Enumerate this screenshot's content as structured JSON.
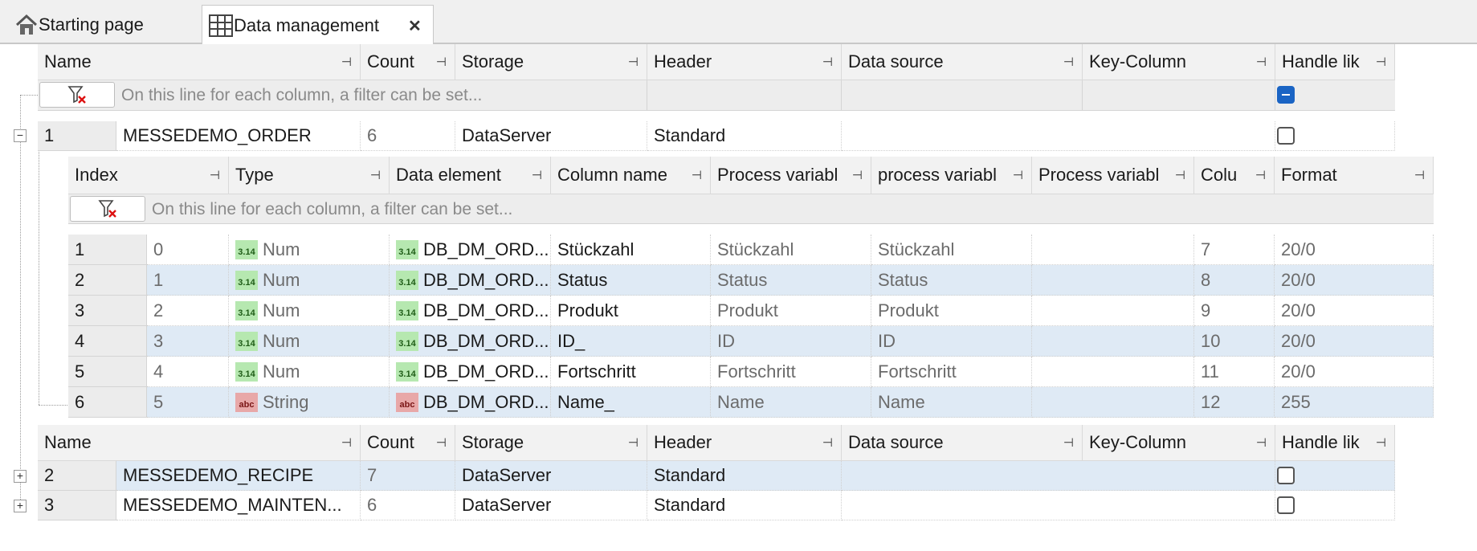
{
  "tabs": [
    {
      "label": "Starting page",
      "icon": "home-icon"
    },
    {
      "label": "Data management",
      "icon": "table-grid-icon",
      "close": "✕"
    }
  ],
  "outer_columns": [
    "Name",
    "Count",
    "Storage",
    "Header",
    "Data source",
    "Key-Column",
    "Handle lik"
  ],
  "filter_placeholder": "On this line for each column, a filter can be set...",
  "tables": [
    {
      "index": "1",
      "name": "MESSEDEMO_ORDER",
      "count": "6",
      "storage": "DataServer",
      "header": "Standard",
      "expanded": true
    },
    {
      "index": "2",
      "name": "MESSEDEMO_RECIPE",
      "count": "7",
      "storage": "DataServer",
      "header": "Standard",
      "expanded": false
    },
    {
      "index": "3",
      "name": "MESSEDEMO_MAINTEN...",
      "count": "6",
      "storage": "DataServer",
      "header": "Standard",
      "expanded": false
    }
  ],
  "inner_columns": [
    "Index",
    "Type",
    "Data element",
    "Column name",
    "Process variabl",
    "process variabl",
    "Process variabl",
    "Colu",
    "Format"
  ],
  "inner_rows": [
    {
      "row": "1",
      "index": "0",
      "type": "Num",
      "type_badge": "3.14",
      "element": "DB_DM_ORD...",
      "column": "Stückzahl",
      "pv1": "Stückzahl",
      "pv2": "Stückzahl",
      "pv3": "",
      "colu": "7",
      "format": "20/0"
    },
    {
      "row": "2",
      "index": "1",
      "type": "Num",
      "type_badge": "3.14",
      "element": "DB_DM_ORD...",
      "column": "Status",
      "pv1": "Status",
      "pv2": "Status",
      "pv3": "",
      "colu": "8",
      "format": "20/0"
    },
    {
      "row": "3",
      "index": "2",
      "type": "Num",
      "type_badge": "3.14",
      "element": "DB_DM_ORD...",
      "column": "Produkt",
      "pv1": "Produkt",
      "pv2": "Produkt",
      "pv3": "",
      "colu": "9",
      "format": "20/0"
    },
    {
      "row": "4",
      "index": "3",
      "type": "Num",
      "type_badge": "3.14",
      "element": "DB_DM_ORD...",
      "column": "ID_",
      "pv1": "ID",
      "pv2": "ID",
      "pv3": "",
      "colu": "10",
      "format": "20/0"
    },
    {
      "row": "5",
      "index": "4",
      "type": "Num",
      "type_badge": "3.14",
      "element": "DB_DM_ORD...",
      "column": "Fortschritt",
      "pv1": "Fortschritt",
      "pv2": "Fortschritt",
      "pv3": "",
      "colu": "11",
      "format": "20/0"
    },
    {
      "row": "6",
      "index": "5",
      "type": "String",
      "type_badge": "abc",
      "element": "DB_DM_ORD...",
      "column": "Name_",
      "pv1": "Name",
      "pv2": "Name",
      "pv3": "",
      "colu": "12",
      "format": "255"
    }
  ],
  "colors": {
    "selected_row": "#dfeaf5",
    "num_badge": "#b6e8b0",
    "string_badge": "#e8a8a8",
    "checkbox_indeterminate": "#1a64c4"
  }
}
